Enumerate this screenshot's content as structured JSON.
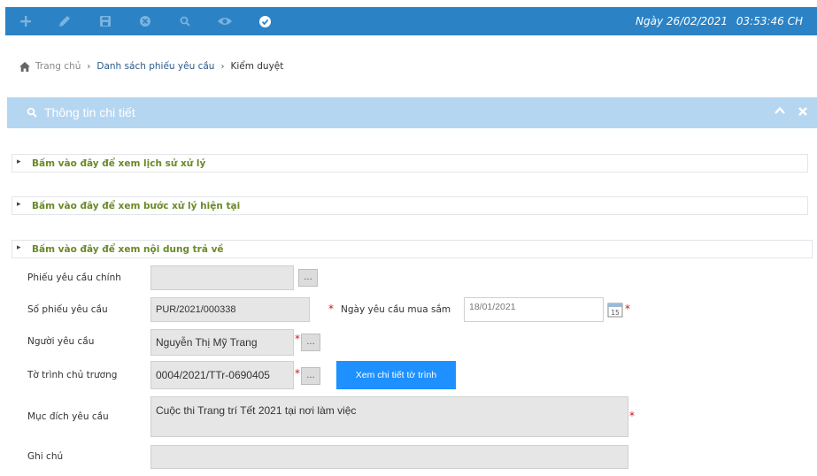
{
  "toolbar": {
    "icons": [
      "add-icon",
      "edit-icon",
      "save-icon",
      "cancel-icon",
      "search-icon",
      "view-icon",
      "approve-icon"
    ],
    "date_label": "Ngày 26/02/2021",
    "time_label": "03:53:46 CH"
  },
  "breadcrumb": {
    "home": "Trang chủ",
    "list": "Danh sách phiếu yêu cầu",
    "current": "Kiểm duyệt"
  },
  "panel": {
    "title": "Thông tin chi tiết"
  },
  "sections": [
    "Bấm vào đây để xem lịch sử xử lý",
    "Bấm vào đây để xem bước xử lý hiện tại",
    "Bấm vào đây để xem nội dung trả về"
  ],
  "form": {
    "main_request_label": "Phiếu yêu cầu chính",
    "main_request_value": "",
    "request_no_label": "Số phiếu yêu cầu",
    "request_no_value": "PUR/2021/000338",
    "purchase_date_label": "Ngày yêu cầu mua sắm",
    "purchase_date_value": "18/01/2021",
    "requester_label": "Người yêu cầu",
    "requester_value": "Nguyễn Thị Mỹ Trang",
    "proposal_label": "Tờ trình chủ trương",
    "proposal_value": "0004/2021/TTr-0690405",
    "proposal_button": "Xem chi tiết tờ trình",
    "purpose_label": "Mục đích yêu cầu",
    "purpose_value": "Cuộc thi Trang trí Tết 2021 tại nơi làm việc",
    "note_label": "Ghi chú",
    "note_value": "",
    "lookup_button": "...",
    "required_mark": "*",
    "calendar_day": "15"
  },
  "colors": {
    "toolbar_bg": "#2b83c6",
    "panel_head_bg": "#b5d6f1",
    "section_label": "#6a8a28",
    "primary_button": "#1e90ff",
    "required": "#d0121b"
  }
}
